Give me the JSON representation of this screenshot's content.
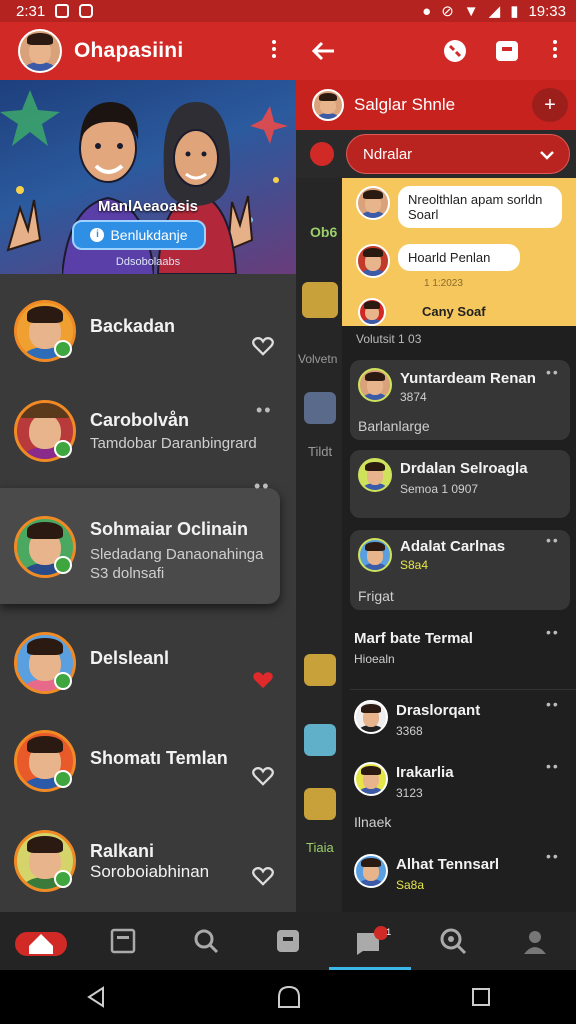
{
  "status_bar": {
    "time_left": "2:31",
    "time_right": "19:33"
  },
  "left_panel": {
    "header": {
      "title": "Ohapasiini"
    },
    "banner": {
      "title": "ManlAeaoasis",
      "button_label": "Benlukdanje",
      "subtitle": "Ddsobolaabs"
    },
    "contacts": [
      {
        "name": "Backadan",
        "sub": "",
        "trailing": "heart-outline"
      },
      {
        "name": "Carobolvån",
        "sub": "Tamdobar Daranbingrard",
        "trailing": "dots"
      },
      {
        "name": "Sohmaiar Oclinain",
        "sub": "Sledadang Danaonahinga",
        "sub2": "S3 dolnsafi",
        "trailing": "none"
      },
      {
        "name": "Delsleanl",
        "sub": "",
        "trailing": "heart-filled"
      },
      {
        "name": "Shomatı Temlan",
        "sub": "",
        "trailing": "heart-outline"
      },
      {
        "name": "Ralkani",
        "sub": "Soroboiabhinan",
        "trailing": "heart-outline"
      }
    ],
    "colors": {
      "accent": "#d12a26",
      "heart": "#e0292b",
      "online": "#3fa63f"
    }
  },
  "right_panel": {
    "chat_title": "Salglar Shnle",
    "selector_label": "Ndralar",
    "highlight_bubbles": [
      {
        "text": "Nreolthlan apam sorldn Soarl"
      },
      {
        "text": "Hoarld Penlan"
      },
      {
        "text": "Cany Soaf",
        "time": "1 1:2023"
      }
    ],
    "section_label": "Volutsit 1 03",
    "strip_labels": [
      "Ob6",
      "Volvetn",
      "Tildt",
      "Tiaia"
    ],
    "cards": [
      {
        "title": "Yuntardeam Renan",
        "sub": "3874",
        "extra": "Barlanlarge",
        "sub_color": "#cfcfcf"
      },
      {
        "title": "Drdalan Selroagla",
        "sub": "Semoa 1 0907",
        "extra": "",
        "sub_color": "#e5e54a"
      },
      {
        "title": "Adalat Carlnas",
        "sub": "S8a4",
        "extra": "Frigat",
        "sub_color": "#e5e54a"
      }
    ],
    "list_items": [
      {
        "title": "Marf bate Termal",
        "sub": "Hioealn"
      },
      {
        "title": "Draslorqant",
        "sub": "3368"
      },
      {
        "title": "Irakarlia",
        "sub": "3123",
        "extra": "Ilnaek"
      },
      {
        "title": "Alhat Tennsarl",
        "sub": "Sa8a",
        "sub_color": "#e5e54a"
      }
    ]
  },
  "bottom_nav": {
    "items": [
      "home-icon",
      "news-icon",
      "search-icon",
      "saved-icon",
      "chat-icon",
      "search-zoom-icon",
      "profile-icon"
    ],
    "active_index": 4,
    "badge": "1"
  }
}
